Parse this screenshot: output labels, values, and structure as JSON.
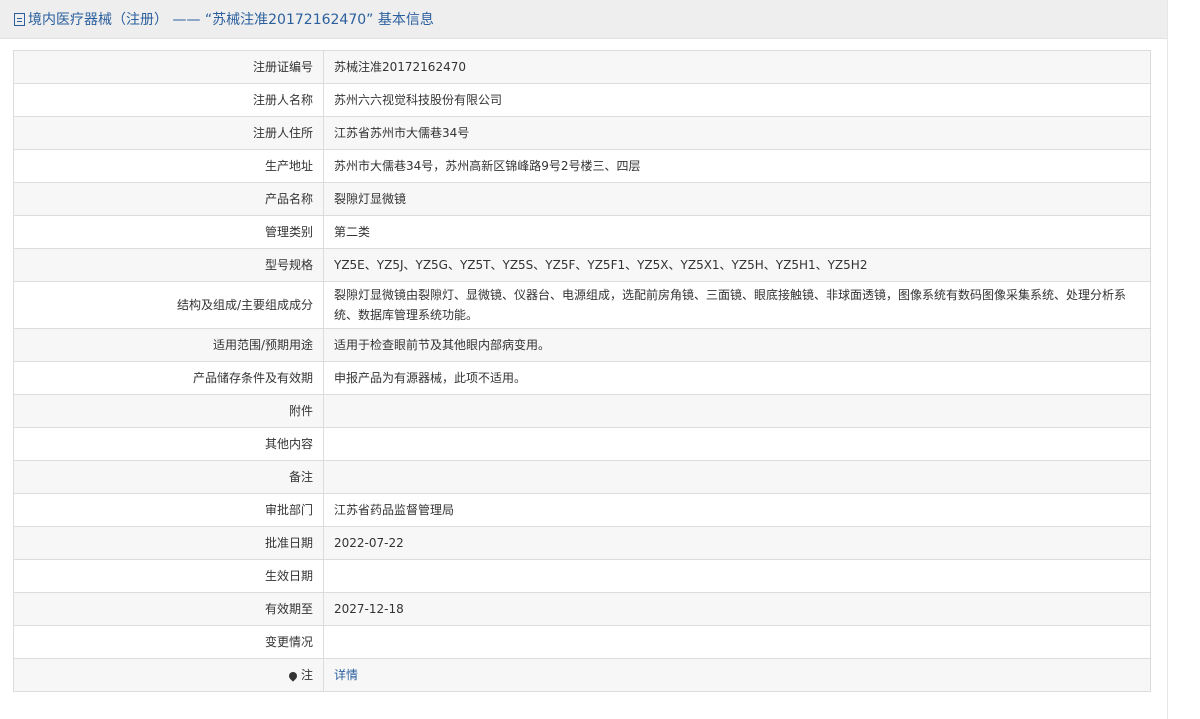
{
  "header": {
    "title": "境内医疗器械（注册） —— “苏械注准20172162470” 基本信息"
  },
  "rows": [
    {
      "label": "注册证编号",
      "value": "苏械注准20172162470"
    },
    {
      "label": "注册人名称",
      "value": "苏州六六视觉科技股份有限公司"
    },
    {
      "label": "注册人住所",
      "value": "江苏省苏州市大儒巷34号"
    },
    {
      "label": "生产地址",
      "value": "苏州市大儒巷34号，苏州高新区锦峰路9号2号楼三、四层"
    },
    {
      "label": "产品名称",
      "value": "裂隙灯显微镜"
    },
    {
      "label": "管理类别",
      "value": "第二类"
    },
    {
      "label": "型号规格",
      "value": "YZ5E、YZ5J、YZ5G、YZ5T、YZ5S、YZ5F、YZ5F1、YZ5X、YZ5X1、YZ5H、YZ5H1、YZ5H2"
    },
    {
      "label": "结构及组成/主要组成成分",
      "value": "裂隙灯显微镜由裂隙灯、显微镜、仪器台、电源组成，选配前房角镜、三面镜、眼底接触镜、非球面透镜，图像系统有数码图像采集系统、处理分析系统、数据库管理系统功能。"
    },
    {
      "label": "适用范围/预期用途",
      "value": "适用于检查眼前节及其他眼内部病变用。"
    },
    {
      "label": "产品储存条件及有效期",
      "value": "申报产品为有源器械，此项不适用。"
    },
    {
      "label": "附件",
      "value": ""
    },
    {
      "label": "其他内容",
      "value": ""
    },
    {
      "label": "备注",
      "value": ""
    },
    {
      "label": "审批部门",
      "value": "江苏省药品监督管理局"
    },
    {
      "label": "批准日期",
      "value": "2022-07-22"
    },
    {
      "label": "生效日期",
      "value": ""
    },
    {
      "label": "有效期至",
      "value": "2027-12-18"
    },
    {
      "label": "变更情况",
      "value": ""
    }
  ],
  "note": {
    "label": "注",
    "icon": "pin-icon",
    "link_text": "详情"
  }
}
